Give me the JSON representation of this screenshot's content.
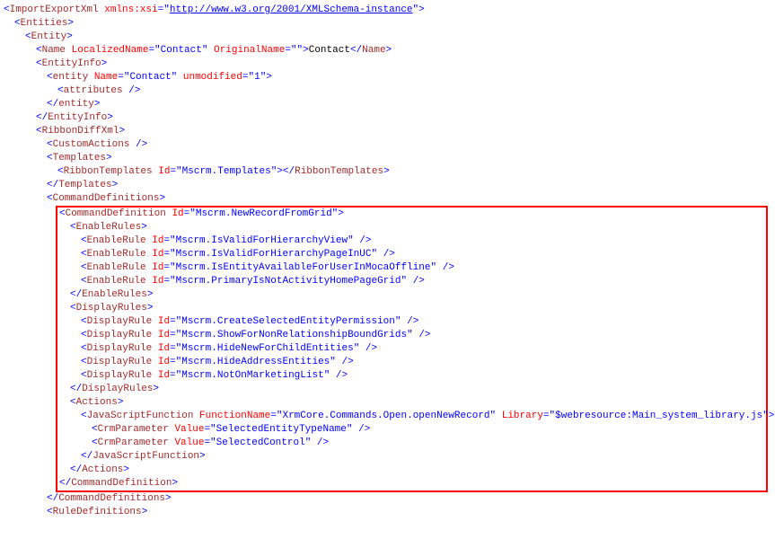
{
  "root": {
    "name": "ImportExportXml",
    "attr": "xmlns:xsi",
    "href": "http://www.w3.org/2001/XMLSchema-instance"
  },
  "entities": "Entities",
  "entity": "Entity",
  "name_el": {
    "tag": "Name",
    "a1n": "LocalizedName",
    "a1v": "Contact",
    "a2n": "OriginalName",
    "a2v": "",
    "text": "Contact"
  },
  "entityinfo": "EntityInfo",
  "entity_l": {
    "tag": "entity",
    "a1n": "Name",
    "a1v": "Contact",
    "a2n": "unmodified",
    "a2v": "1"
  },
  "attributes": "attributes",
  "ribbondiff": "RibbonDiffXml",
  "customactions": "CustomActions",
  "templates": "Templates",
  "ribbontemplates": {
    "tag": "RibbonTemplates",
    "an": "Id",
    "av": "Mscrm.Templates"
  },
  "commanddefs": "CommandDefinitions",
  "cmddef": {
    "tag": "CommandDefinition",
    "an": "Id",
    "av": "Mscrm.NewRecordFromGrid"
  },
  "enablerules": "EnableRules",
  "er_tag": "EnableRule",
  "er_an": "Id",
  "er": [
    "Mscrm.IsValidForHierarchyView",
    "Mscrm.IsValidForHierarchyPageInUC",
    "Mscrm.IsEntityAvailableForUserInMocaOffline",
    "Mscrm.PrimaryIsNotActivityHomePageGrid"
  ],
  "displayrules": "DisplayRules",
  "dr_tag": "DisplayRule",
  "dr_an": "Id",
  "dr": [
    "Mscrm.CreateSelectedEntityPermission",
    "Mscrm.ShowForNonRelationshipBoundGrids",
    "Mscrm.HideNewForChildEntities",
    "Mscrm.HideAddressEntities",
    "Mscrm.NotOnMarketingList"
  ],
  "actions": "Actions",
  "jsf": {
    "tag": "JavaScriptFunction",
    "a1n": "FunctionName",
    "a1v": "XrmCore.Commands.Open.openNewRecord",
    "a2n": "Library",
    "a2v": "$webresource:Main_system_library.js"
  },
  "crmp_tag": "CrmParameter",
  "crmp_an": "Value",
  "crmp": [
    "SelectedEntityTypeName",
    "SelectedControl"
  ],
  "ruledefs": "RuleDefinitions"
}
